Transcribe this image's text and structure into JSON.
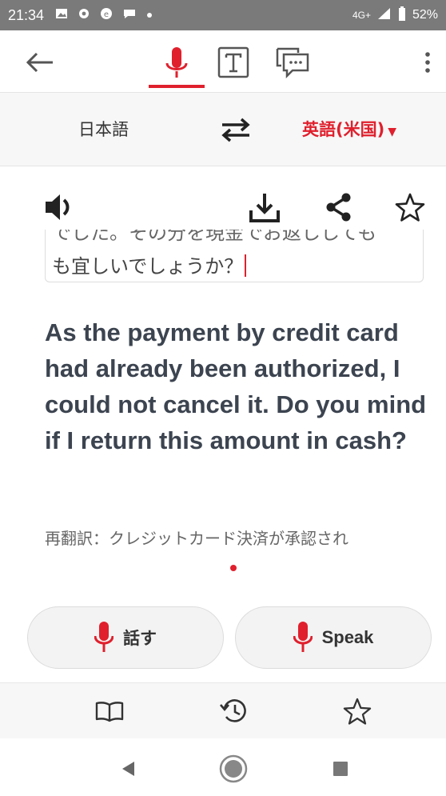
{
  "status_bar": {
    "time": "21:34",
    "network": "4G+",
    "battery": "52%",
    "icons_left": [
      "image-icon",
      "gear-icon",
      "notification-icon",
      "chat-bubble-icon",
      "dot-icon"
    ]
  },
  "header": {
    "tabs": [
      {
        "icon": "microphone-icon",
        "active": true
      },
      {
        "icon": "text-icon",
        "active": false
      },
      {
        "icon": "chat-icon",
        "active": false
      }
    ]
  },
  "languages": {
    "source": "日本語",
    "target": "英語(米国)"
  },
  "source_text": {
    "partial_line": "でした。その分を現金でお返ししても",
    "last_line": "も宜しいでしょうか？"
  },
  "translation": "As the payment by credit card had already been authorized, I could not cancel it. Do you mind if I return this amount in cash?",
  "retranslation": "再翻訳：クレジットカード決済が承認され",
  "speak_buttons": {
    "japanese": "話す",
    "english": "Speak"
  },
  "colors": {
    "accent": "#e0202d",
    "text_dark": "#3c4450",
    "status_bar": "#7a7a7a"
  }
}
